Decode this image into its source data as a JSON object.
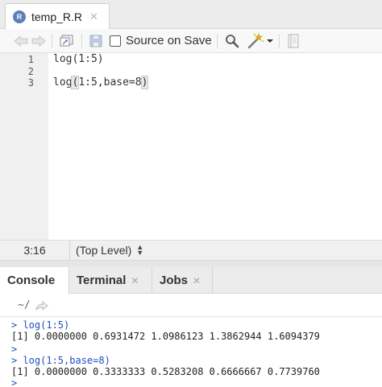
{
  "editor": {
    "tab": {
      "icon": "r-file-icon",
      "icon_text": "R",
      "name": "temp_R.R",
      "close": "✕"
    },
    "toolbar": {
      "source_on_save_label": "Source on Save",
      "source_on_save_checked": false
    },
    "lines": [
      {
        "num": "1",
        "code": "log(1:5)"
      },
      {
        "num": "2",
        "code": ""
      },
      {
        "num": "3",
        "code_pre": "log",
        "code_paren_open": "(",
        "code_mid": "1:5,base=8",
        "code_paren_close": ")"
      }
    ]
  },
  "status": {
    "position": "3:16",
    "scope": "(Top Level)"
  },
  "console_pane": {
    "tabs": [
      {
        "label": "Console",
        "active": true
      },
      {
        "label": "Terminal",
        "close": "✕"
      },
      {
        "label": "Jobs",
        "close": "✕"
      }
    ],
    "working_dir": "~/",
    "output": [
      {
        "kind": "cmd",
        "text": "> log(1:5)"
      },
      {
        "kind": "out",
        "text": "[1] 0.0000000 0.6931472 1.0986123 1.3862944 1.6094379"
      },
      {
        "kind": "cmd",
        "text": ">"
      },
      {
        "kind": "cmd",
        "text": "> log(1:5,base=8)"
      },
      {
        "kind": "out",
        "text": "[1] 0.0000000 0.3333333 0.5283208 0.6666667 0.7739760"
      },
      {
        "kind": "cmd",
        "text": ">"
      }
    ]
  },
  "colors": {
    "console_command": "#1f4fbf",
    "r_icon": "#5a7fb8",
    "save_icon": "#9aaec8"
  }
}
